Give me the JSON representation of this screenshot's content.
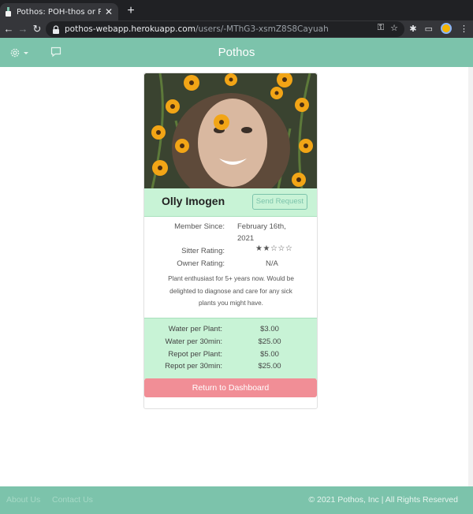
{
  "browser": {
    "tab_title": "Pothos: POH-thos or PAH-thos",
    "url_host": "pothos-webapp.herokuapp.com",
    "url_path": "/users/-MThG3-xsmZ8S8Cayuah"
  },
  "app": {
    "brand": "Pothos"
  },
  "profile": {
    "name": "Olly Imogen",
    "send_request": "Send Request",
    "member_since_label": "Member Since:",
    "member_since_value": "February 16th, 2021",
    "sitter_rating_label": "Sitter Rating:",
    "sitter_rating_stars": 2,
    "sitter_rating_max": 5,
    "owner_rating_label": "Owner Rating:",
    "owner_rating_value": "N/A",
    "bio": "Plant enthusiast for 5+ years now. Would be delighted to diagnose and care for any sick plants you might have."
  },
  "prices": [
    {
      "label": "Water per Plant:",
      "value": "$3.00"
    },
    {
      "label": "Water per 30min:",
      "value": "$25.00"
    },
    {
      "label": "Repot per Plant:",
      "value": "$5.00"
    },
    {
      "label": "Repot per 30min:",
      "value": "$25.00"
    }
  ],
  "return_button": "Return to Dashboard",
  "footer": {
    "about": "About Us",
    "contact": "Contact Us",
    "copyright": "© 2021 Pothos, Inc | All Rights Reserved"
  },
  "colors": {
    "accent": "#7cc3ab",
    "panel": "#c8f3d6",
    "button": "#f18e96"
  }
}
